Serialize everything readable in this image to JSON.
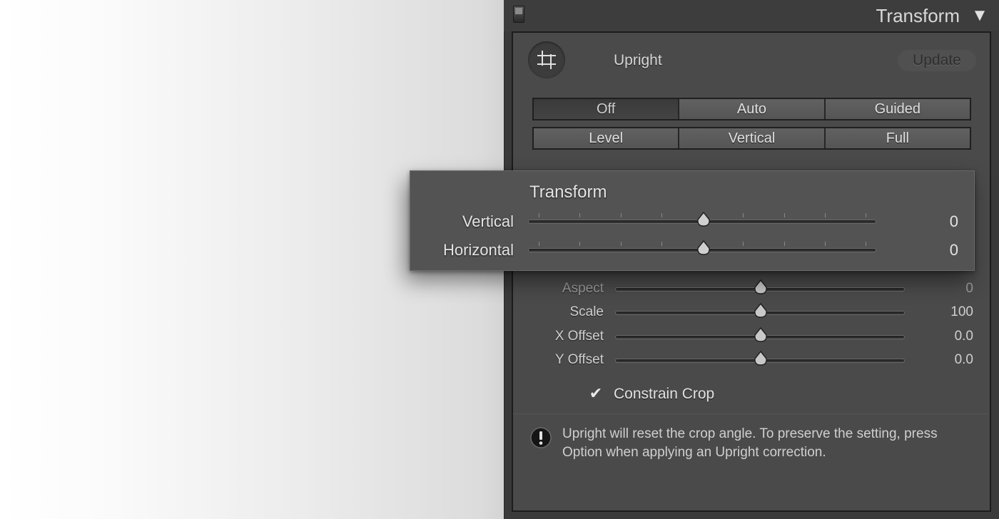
{
  "panel": {
    "title": "Transform",
    "collapse_arrow": "▼",
    "upright": {
      "label": "Upright",
      "crop_icon": "crop-icon",
      "update_label": "Update",
      "modes_row1": [
        "Off",
        "Auto",
        "Guided"
      ],
      "modes_row2": [
        "Level",
        "Vertical",
        "Full"
      ],
      "selected_mode": "Off"
    },
    "sliders": [
      {
        "label": "Aspect",
        "value": "0"
      },
      {
        "label": "Scale",
        "value": "100"
      },
      {
        "label": "X Offset",
        "value": "0.0"
      },
      {
        "label": "Y Offset",
        "value": "0.0"
      }
    ],
    "constrain_crop": {
      "label": "Constrain Crop",
      "checked": true,
      "check_glyph": "✔"
    },
    "warning": {
      "icon": "exclamation-icon",
      "text": "Upright will reset the crop angle. To preserve the setting, press Option when applying an Upright correction."
    }
  },
  "popup": {
    "title": "Transform",
    "sliders": [
      {
        "label": "Vertical",
        "value": "0"
      },
      {
        "label": "Horizontal",
        "value": "0"
      }
    ]
  },
  "colors": {
    "panel_background": "#4a4a4a",
    "popup_background": "#535353",
    "text": "#e0e0e0"
  }
}
